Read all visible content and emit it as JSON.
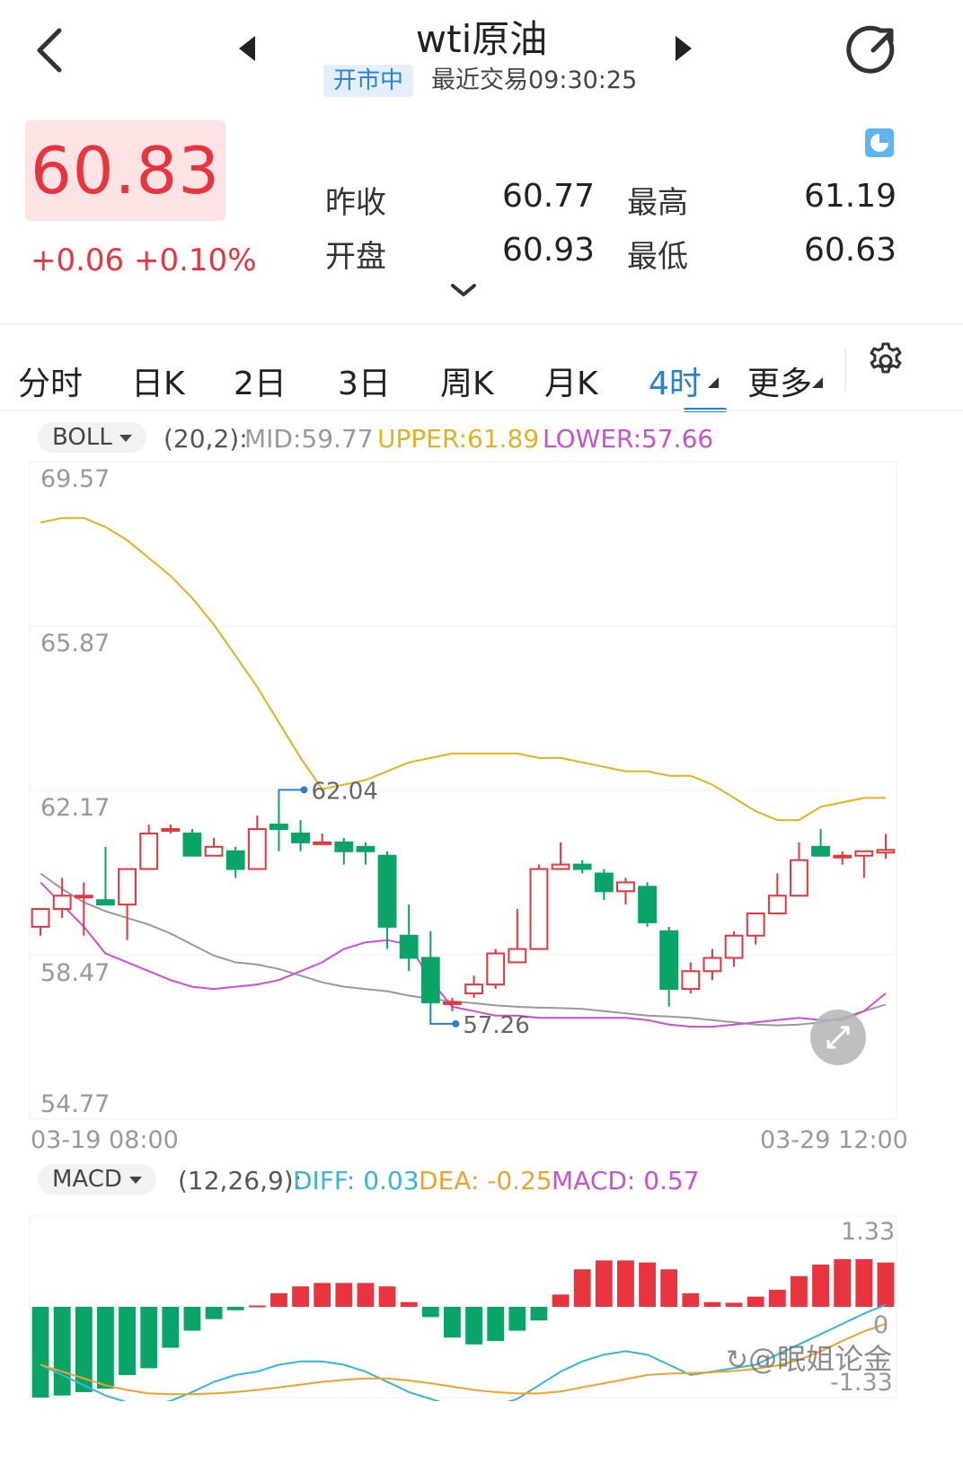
{
  "header": {
    "title": "wti原油",
    "status": "开市中",
    "last_trade": "最近交易09:30:25"
  },
  "quote": {
    "price": "60.83",
    "change": "+0.06 +0.10%",
    "prev_close_label": "昨收",
    "prev_close": "60.77",
    "open_label": "开盘",
    "open": "60.93",
    "high_label": "最高",
    "high": "61.19",
    "low_label": "最低",
    "low": "60.63"
  },
  "tabs": [
    "分时",
    "日K",
    "2日",
    "3日",
    "周K",
    "月K",
    "4时",
    "更多"
  ],
  "active_tab": "4时",
  "colors": {
    "up": "#e8343f",
    "down": "#0aa469",
    "mid": "#999999",
    "upper": "#e3b21c",
    "lower": "#c94fd4",
    "diff": "#35b5d8",
    "dea": "#f0a22e",
    "accent": "#2a7fd4"
  },
  "boll": {
    "button_label": "BOLL",
    "params": "(20,2):",
    "mid_text": "MID:59.77",
    "upper_text": "UPPER:61.89",
    "lower_text": "LOWER:57.66",
    "y_axis_labels": [
      "69.57",
      "65.87",
      "62.17",
      "58.47",
      "54.77"
    ],
    "date_start": "03-19 08:00",
    "date_end": "03-29 12:00",
    "max_marker": "62.04",
    "min_marker": "57.26"
  },
  "macd": {
    "button_label": "MACD",
    "params": "(12,26,9):",
    "diff_text": "DIFF: 0.03",
    "dea_text": "DEA: -0.25",
    "macd_text": "MACD: 0.57",
    "y_axis_labels": [
      "1.33",
      "0",
      "-1.33"
    ]
  },
  "watermark": "@眠姐论金",
  "chart_data": {
    "type": "candlestick",
    "ylim": [
      54.77,
      69.57
    ],
    "candles": [
      {
        "o": 59.1,
        "c": 59.5,
        "h": 59.5,
        "l": 58.9
      },
      {
        "o": 59.5,
        "c": 59.8,
        "h": 60.2,
        "l": 59.3
      },
      {
        "o": 59.8,
        "c": 59.8,
        "h": 60.1,
        "l": 58.9
      },
      {
        "o": 59.7,
        "c": 59.6,
        "h": 60.9,
        "l": 59.6
      },
      {
        "o": 59.6,
        "c": 60.4,
        "h": 60.4,
        "l": 58.8
      },
      {
        "o": 60.4,
        "c": 61.2,
        "h": 61.4,
        "l": 60.4
      },
      {
        "o": 61.3,
        "c": 61.3,
        "h": 61.4,
        "l": 61.2
      },
      {
        "o": 61.2,
        "c": 60.7,
        "h": 61.3,
        "l": 60.7
      },
      {
        "o": 60.7,
        "c": 60.9,
        "h": 61.1,
        "l": 60.7
      },
      {
        "o": 60.8,
        "c": 60.4,
        "h": 60.9,
        "l": 60.2
      },
      {
        "o": 60.4,
        "c": 61.3,
        "h": 61.6,
        "l": 60.4
      },
      {
        "o": 61.4,
        "c": 61.3,
        "h": 61.9,
        "l": 60.8
      },
      {
        "o": 61.2,
        "c": 61.0,
        "h": 61.5,
        "l": 60.8
      },
      {
        "o": 61.0,
        "c": 61.0,
        "h": 61.2,
        "l": 61.0
      },
      {
        "o": 61.0,
        "c": 60.8,
        "h": 61.1,
        "l": 60.5
      },
      {
        "o": 60.9,
        "c": 60.8,
        "h": 61.0,
        "l": 60.5
      },
      {
        "o": 60.7,
        "c": 59.1,
        "h": 60.8,
        "l": 58.6
      },
      {
        "o": 58.9,
        "c": 58.4,
        "h": 59.6,
        "l": 58.1
      },
      {
        "o": 58.4,
        "c": 57.4,
        "h": 59.0,
        "l": 57.2
      },
      {
        "o": 57.4,
        "c": 57.4,
        "h": 57.5,
        "l": 57.2
      },
      {
        "o": 57.6,
        "c": 57.8,
        "h": 58.0,
        "l": 57.5
      },
      {
        "o": 57.8,
        "c": 58.5,
        "h": 58.6,
        "l": 57.7
      },
      {
        "o": 58.3,
        "c": 58.6,
        "h": 59.5,
        "l": 58.3
      },
      {
        "o": 58.6,
        "c": 60.4,
        "h": 60.5,
        "l": 58.6
      },
      {
        "o": 60.4,
        "c": 60.5,
        "h": 61.0,
        "l": 60.4
      },
      {
        "o": 60.5,
        "c": 60.4,
        "h": 60.6,
        "l": 60.3
      },
      {
        "o": 60.3,
        "c": 59.9,
        "h": 60.4,
        "l": 59.7
      },
      {
        "o": 59.9,
        "c": 60.1,
        "h": 60.2,
        "l": 59.6
      },
      {
        "o": 60.0,
        "c": 59.2,
        "h": 60.1,
        "l": 59.1
      },
      {
        "o": 59.0,
        "c": 57.7,
        "h": 59.1,
        "l": 57.3
      },
      {
        "o": 57.7,
        "c": 58.1,
        "h": 58.3,
        "l": 57.6
      },
      {
        "o": 58.1,
        "c": 58.4,
        "h": 58.6,
        "l": 57.9
      },
      {
        "o": 58.4,
        "c": 58.9,
        "h": 59.0,
        "l": 58.2
      },
      {
        "o": 58.9,
        "c": 59.4,
        "h": 59.4,
        "l": 58.7
      },
      {
        "o": 59.4,
        "c": 59.8,
        "h": 60.3,
        "l": 59.4
      },
      {
        "o": 59.8,
        "c": 60.6,
        "h": 61.0,
        "l": 59.8
      },
      {
        "o": 60.9,
        "c": 60.7,
        "h": 61.3,
        "l": 60.7
      },
      {
        "o": 60.7,
        "c": 60.7,
        "h": 60.8,
        "l": 60.5
      },
      {
        "o": 60.7,
        "c": 60.8,
        "h": 60.8,
        "l": 60.2
      },
      {
        "o": 60.77,
        "c": 60.83,
        "h": 61.19,
        "l": 60.63
      }
    ],
    "mid": [
      60.3,
      59.95,
      59.65,
      59.45,
      59.3,
      59.15,
      58.95,
      58.7,
      58.45,
      58.3,
      58.25,
      58.15,
      58.0,
      57.85,
      57.75,
      57.7,
      57.65,
      57.55,
      57.48,
      57.42,
      57.38,
      57.33,
      57.3,
      57.28,
      57.27,
      57.25,
      57.2,
      57.15,
      57.1,
      57.08,
      57.05,
      57.0,
      56.95,
      56.9,
      56.88,
      56.9,
      56.95,
      57.05,
      57.2,
      57.35
    ],
    "upper": [
      68.2,
      68.3,
      68.3,
      68.1,
      67.8,
      67.4,
      67.0,
      66.5,
      65.9,
      65.2,
      64.5,
      63.7,
      62.9,
      62.2,
      62.3,
      62.4,
      62.6,
      62.8,
      62.9,
      63.0,
      63.0,
      63.0,
      63.0,
      62.9,
      62.9,
      62.8,
      62.7,
      62.6,
      62.6,
      62.5,
      62.5,
      62.3,
      62.0,
      61.7,
      61.5,
      61.5,
      61.8,
      61.9,
      62.0,
      62.0
    ],
    "lower": [
      60.1,
      59.6,
      59.1,
      58.5,
      58.3,
      58.1,
      57.9,
      57.75,
      57.7,
      57.75,
      57.8,
      57.9,
      58.1,
      58.3,
      58.6,
      58.75,
      58.8,
      58.7,
      57.9,
      57.3,
      57.2,
      57.1,
      57.1,
      57.05,
      57.05,
      57.05,
      57.05,
      57.05,
      57.0,
      56.9,
      56.85,
      56.85,
      56.9,
      56.95,
      57.0,
      57.05,
      57.0,
      57.0,
      57.2,
      57.6
    ],
    "macd_hist": [
      -1.33,
      -1.3,
      -1.25,
      -1.2,
      -1.0,
      -0.9,
      -0.6,
      -0.35,
      -0.18,
      -0.05,
      0.02,
      0.2,
      0.3,
      0.35,
      0.35,
      0.35,
      0.3,
      0.07,
      -0.15,
      -0.45,
      -0.55,
      -0.5,
      -0.35,
      -0.2,
      0.18,
      0.55,
      0.68,
      0.68,
      0.65,
      0.55,
      0.2,
      0.07,
      0.06,
      0.15,
      0.25,
      0.45,
      0.62,
      0.7,
      0.7,
      0.65
    ],
    "diff": [
      -0.85,
      -1.0,
      -1.15,
      -1.3,
      -1.4,
      -1.45,
      -1.38,
      -1.25,
      -1.1,
      -1.0,
      -0.95,
      -0.85,
      -0.8,
      -0.8,
      -0.85,
      -0.95,
      -1.1,
      -1.25,
      -1.35,
      -1.45,
      -1.5,
      -1.45,
      -1.35,
      -1.15,
      -0.95,
      -0.8,
      -0.7,
      -0.65,
      -0.7,
      -0.85,
      -1.0,
      -0.95,
      -0.9,
      -0.85,
      -0.7,
      -0.55,
      -0.4,
      -0.25,
      -0.1,
      0.03
    ],
    "dea": [
      -0.85,
      -0.95,
      -1.05,
      -1.15,
      -1.22,
      -1.27,
      -1.28,
      -1.28,
      -1.27,
      -1.25,
      -1.22,
      -1.18,
      -1.14,
      -1.1,
      -1.07,
      -1.05,
      -1.05,
      -1.08,
      -1.12,
      -1.17,
      -1.22,
      -1.25,
      -1.27,
      -1.27,
      -1.24,
      -1.18,
      -1.12,
      -1.06,
      -1.0,
      -0.98,
      -0.97,
      -0.96,
      -0.94,
      -0.91,
      -0.86,
      -0.78,
      -0.65,
      -0.5,
      -0.36,
      -0.25
    ],
    "macd_ylim": [
      -1.33,
      1.33
    ]
  }
}
